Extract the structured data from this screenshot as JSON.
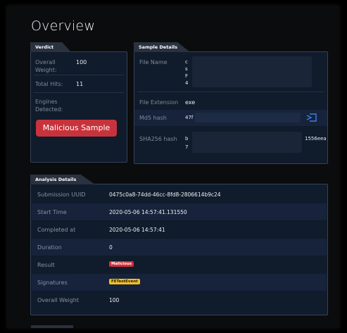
{
  "page": {
    "title": "Overview"
  },
  "verdict": {
    "tab": "Verdict",
    "overall_weight_label": "Overall Weight:",
    "overall_weight_value": "100",
    "total_hits_label": "Total Hits:",
    "total_hits_value": "11",
    "engines_detected_label": "Engines Detected:",
    "button_label": "Malicious Sample"
  },
  "sample": {
    "tab": "Sample Details",
    "file_name_label": "File Name",
    "file_name_lines": [
      "c",
      "s",
      "F",
      "4"
    ],
    "file_ext_label": "File Extension",
    "file_ext_value": "exe",
    "md5_label": "Md5 hash",
    "md5_value": "47f",
    "sha256_label": "SHA256 hash",
    "sha256_line1_start": "b",
    "sha256_line1_end": "1556eea",
    "sha256_line2": "7"
  },
  "analysis": {
    "tab": "Analysis Details",
    "rows": [
      {
        "label": "Submission UUID",
        "value": "0475c0a8-74dd-46cc-8fd8-2806614b9c24"
      },
      {
        "label": "Start Time",
        "value": "2020-05-06 14:57:41.131550"
      },
      {
        "label": "Completed at",
        "value": "2020-05-06 14:57:41"
      },
      {
        "label": "Duration",
        "value": "0"
      },
      {
        "label": "Result",
        "value": "Malicious"
      },
      {
        "label": "Signatures",
        "value": "FETestEvent"
      },
      {
        "label": "Overall Weight",
        "value": "100"
      }
    ]
  },
  "colors": {
    "panel_bg": "#101b2b",
    "malicious": "#c7333c",
    "signature_badge": "#f0bf2a",
    "hash_link_icon": "#3d7de0"
  },
  "icons": {
    "md5_action": "export-icon"
  }
}
